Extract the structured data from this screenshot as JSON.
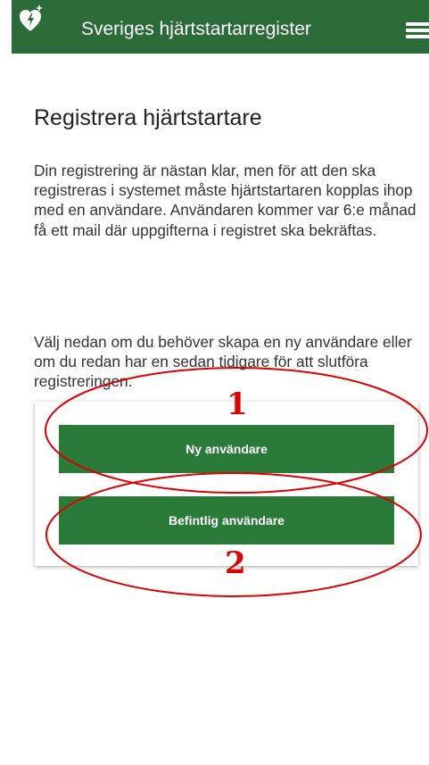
{
  "header": {
    "title": "Sveriges hjärtstartarregister",
    "background_color": "#2a6b38",
    "logo_icon": "heart-defibrillator-logo-icon",
    "menu_icon": "hamburger-menu-icon"
  },
  "main": {
    "title": "Registrera hjärtstartare",
    "paragraph_1": "Din registrering är nästan klar, men för att den ska registreras i systemet måste hjärtstartaren kopplas ihop med en användare. Användaren kommer var 6:e månad få ett mail där uppgifterna i registret ska bekräftas.",
    "paragraph_2": "Välj nedan om du behöver skapa en ny användare eller om du redan har en sedan tidigare för att slutföra registreringen."
  },
  "actions": {
    "new_user_label": "Ny användare",
    "existing_user_label": "Befintlig användare",
    "button_color": "#2a7a3a"
  },
  "annotations": {
    "marker_1": "1",
    "marker_2": "2",
    "color": "#dd0000"
  }
}
